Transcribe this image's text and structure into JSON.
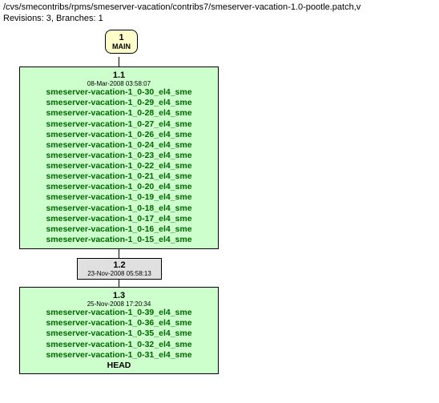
{
  "header": {
    "path": "/cvs/smecontribs/rpms/smeserver-vacation/contribs7/smeserver-vacation-1.0-pootle.patch,v",
    "meta": "Revisions: 3, Branches: 1"
  },
  "main_branch": {
    "num": "1",
    "label": "MAIN"
  },
  "rev1": {
    "num": "1.1",
    "date": "08-Mar-2008 03:58:07",
    "tags": [
      "smeserver-vacation-1_0-30_el4_sme",
      "smeserver-vacation-1_0-29_el4_sme",
      "smeserver-vacation-1_0-28_el4_sme",
      "smeserver-vacation-1_0-27_el4_sme",
      "smeserver-vacation-1_0-26_el4_sme",
      "smeserver-vacation-1_0-24_el4_sme",
      "smeserver-vacation-1_0-23_el4_sme",
      "smeserver-vacation-1_0-22_el4_sme",
      "smeserver-vacation-1_0-21_el4_sme",
      "smeserver-vacation-1_0-20_el4_sme",
      "smeserver-vacation-1_0-19_el4_sme",
      "smeserver-vacation-1_0-18_el4_sme",
      "smeserver-vacation-1_0-17_el4_sme",
      "smeserver-vacation-1_0-16_el4_sme",
      "smeserver-vacation-1_0-15_el4_sme"
    ]
  },
  "sep": {
    "num": "1.2",
    "date": "23-Nov-2008 05:58:13"
  },
  "rev2": {
    "num": "1.3",
    "date": "25-Nov-2008 17:20:34",
    "tags": [
      "smeserver-vacation-1_0-39_el4_sme",
      "smeserver-vacation-1_0-36_el4_sme",
      "smeserver-vacation-1_0-35_el4_sme",
      "smeserver-vacation-1_0-32_el4_sme",
      "smeserver-vacation-1_0-31_el4_sme"
    ],
    "head": "HEAD"
  }
}
